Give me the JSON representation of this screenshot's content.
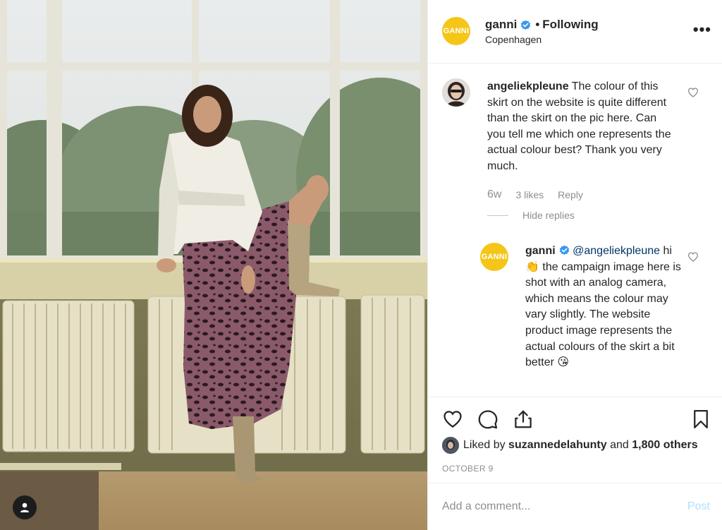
{
  "post": {
    "username": "ganni",
    "avatar_text": "GANNI",
    "follow_status": "Following",
    "separator": "•",
    "location": "Copenhagen",
    "more_label": "•••"
  },
  "comments": [
    {
      "username": "angeliekpleune",
      "text": "The colour of this skirt on the website is quite different than the skirt on the pic here. Can you tell me which one represents the actual colour best? Thank you very much.",
      "age": "6w",
      "likes": "3 likes",
      "reply_label": "Reply",
      "hide_replies": "Hide replies"
    }
  ],
  "reply": {
    "username": "ganni",
    "avatar_text": "GANNI",
    "mention": "@angeliekpleune",
    "text_part1": "hi",
    "emoji1": "👏",
    "text_part2": "the campaign image here is shot with an analog camera, which means the colour may vary slightly. The website product image represents the actual colours of the skirt a bit better",
    "emoji2": "😘"
  },
  "engagement": {
    "liked_by_prefix": "Liked by",
    "liked_by_user": "suzannedelahunty",
    "liked_by_and": "and",
    "others": "1,800 others",
    "date": "OCTOBER 9"
  },
  "composer": {
    "placeholder": "Add a comment...",
    "post_label": "Post"
  },
  "icons": {
    "verified": "verified-badge-icon",
    "like": "heart-icon",
    "comment": "comment-bubble-icon",
    "share": "share-icon",
    "save": "bookmark-icon",
    "tag": "user-tag-icon"
  },
  "colors": {
    "brand_yellow": "#f5c518",
    "verified_blue": "#3897f0",
    "mention_blue": "#003569",
    "muted_gray": "#8e8e8e",
    "post_disabled": "#b2dffc"
  }
}
